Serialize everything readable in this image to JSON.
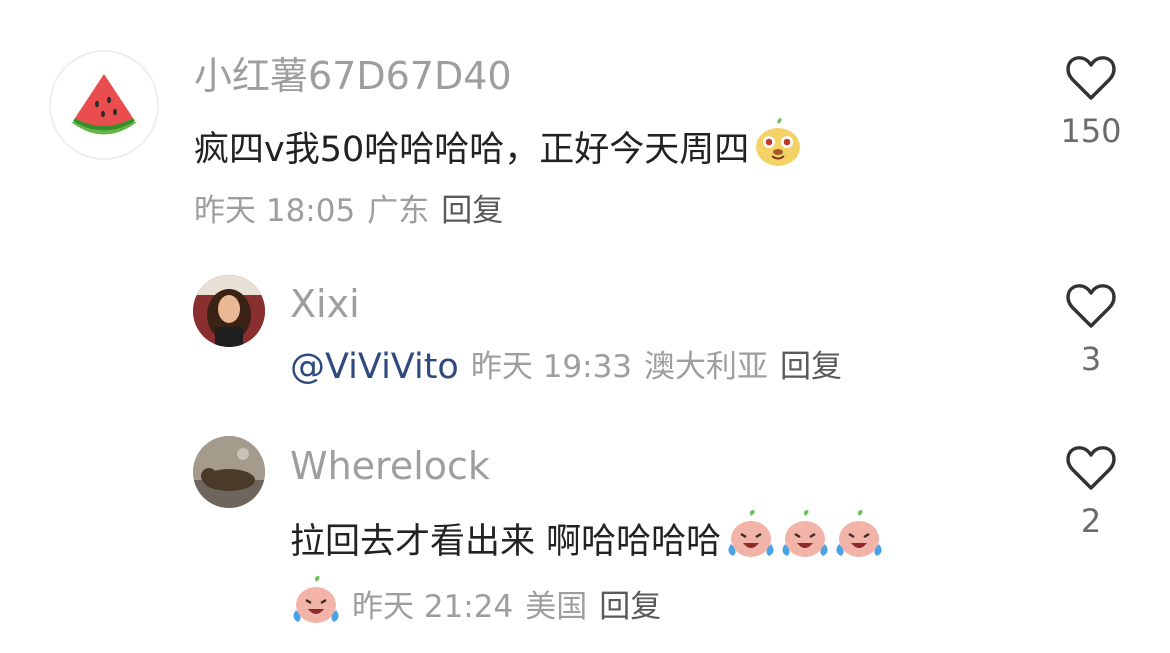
{
  "comment": {
    "username": "小红薯67D67D40",
    "text": "疯四v我50哈哈哈哈，正好今天周四",
    "emoji": "bun-smile-emoji",
    "time": "昨天 18:05",
    "location": "广东",
    "reply_label": "回复",
    "likes": "150"
  },
  "replies": [
    {
      "username": "Xixi",
      "mention": "@ViViVito",
      "time": "昨天 19:33",
      "location": "澳大利亚",
      "reply_label": "回复",
      "likes": "3"
    },
    {
      "username": "Wherelock",
      "text": "拉回去才看出来 啊哈哈哈哈",
      "emoji": "laugh-cry-emoji",
      "time": "昨天 21:24",
      "location": "美国",
      "reply_label": "回复",
      "likes": "2"
    }
  ],
  "colors": {
    "name": "#9e9e9e",
    "text": "#222222",
    "mention": "#2f4a7e"
  }
}
